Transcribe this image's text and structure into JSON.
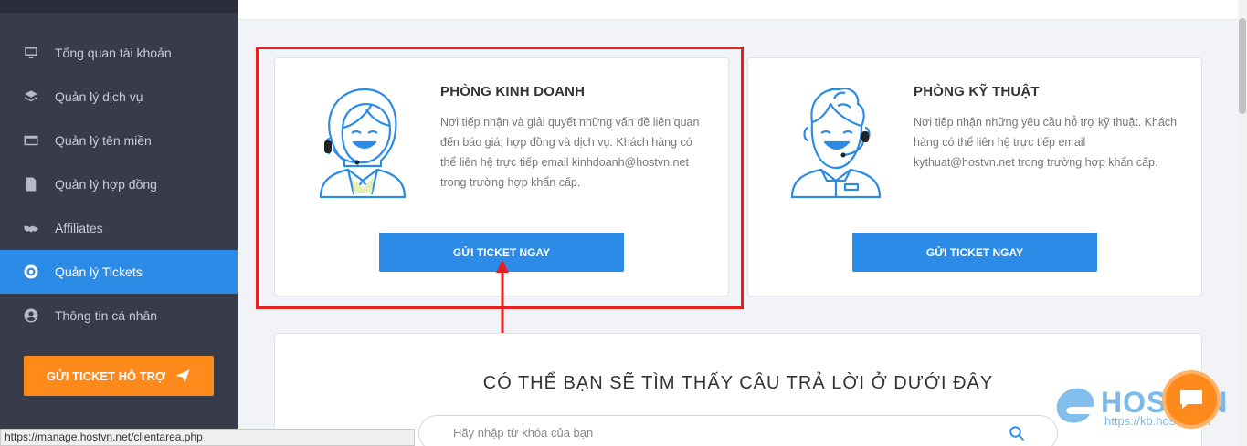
{
  "sidebar": {
    "items": [
      {
        "label": "Tổng quan tài khoản",
        "icon": "monitor-icon"
      },
      {
        "label": "Quản lý dịch vụ",
        "icon": "layers-icon"
      },
      {
        "label": "Quản lý tên miền",
        "icon": "domain-icon"
      },
      {
        "label": "Quản lý hợp đồng",
        "icon": "document-icon"
      },
      {
        "label": "Affiliates",
        "icon": "handshake-icon"
      },
      {
        "label": "Quản lý Tickets",
        "icon": "lifebuoy-icon",
        "active": true
      },
      {
        "label": "Thông tin cá nhân",
        "icon": "user-icon"
      }
    ],
    "support_button": "GỬI TICKET HỖ TRỢ"
  },
  "departments": [
    {
      "title": "PHÒNG KINH DOANH",
      "desc": "Nơi tiếp nhận và giải quyết những vấn đề liên quan đến báo giá, hợp đồng và dịch vụ. Khách hàng có thể liên hệ trực tiếp email kinhdoanh@hostvn.net trong trường hợp khẩn cấp.",
      "button": "GỬI TICKET NGAY"
    },
    {
      "title": "PHÒNG KỸ THUẬT",
      "desc": "Nơi tiếp nhận những yêu cầu hỗ trợ kỹ thuật. Khách hàng có thể liên hệ trực tiếp email kythuat@hostvn.net trong trường hợp khẩn cấp.",
      "button": "GỬI TICKET NGAY"
    }
  ],
  "faq": {
    "title": "CÓ THỂ BẠN SẼ TÌM THẤY CÂU TRẢ LỜI Ở DƯỚI ĐÂY",
    "search_placeholder": "Hãy nhập từ khóa của bạn"
  },
  "watermark": {
    "brand": "HOSTVN",
    "url": "https://kb.hostvn.net"
  },
  "status_url": "https://manage.hostvn.net/clientarea.php",
  "colors": {
    "primary": "#2b8be6",
    "accent": "#ff8a1c",
    "sidebar": "#373b4a",
    "highlight": "#e52020"
  }
}
